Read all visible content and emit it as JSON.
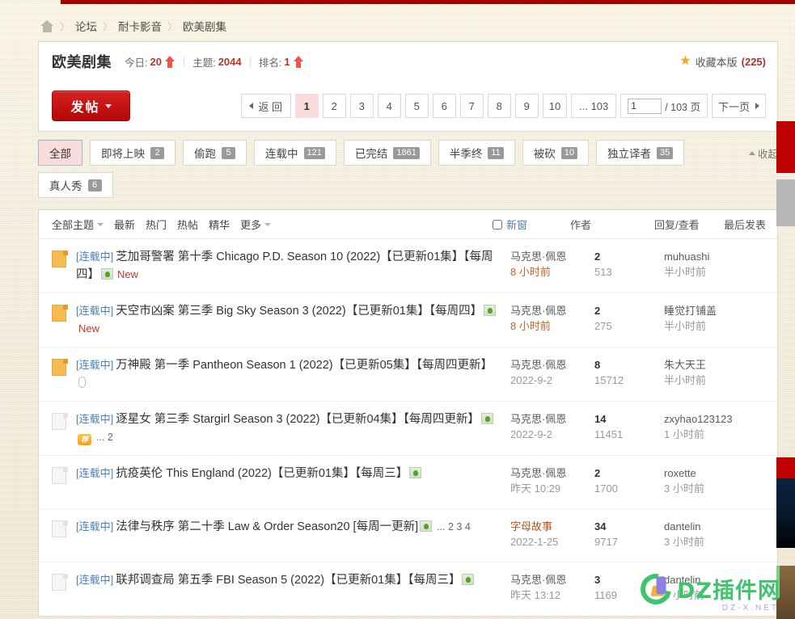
{
  "breadcrumb": {
    "home_icon": "home-icon",
    "items": [
      "论坛",
      "耐卡影音",
      "欧美剧集"
    ],
    "separator": "〉"
  },
  "forum_header": {
    "title": "欧美剧集",
    "today_label": "今日:",
    "today_value": "20",
    "threads_label": "主题:",
    "threads_value": "2044",
    "rank_label": "排名:",
    "rank_value": "1",
    "favorite_label": "收藏本版",
    "favorite_count": "(225)",
    "star_icon": "star-icon"
  },
  "actionbar": {
    "post_label": "发帖",
    "pager": {
      "back_label": "返 回",
      "pages": [
        "1",
        "2",
        "3",
        "4",
        "5",
        "6",
        "7",
        "8",
        "9",
        "10"
      ],
      "current": "1",
      "ellipsis_last": "... 103",
      "jump_value": "1",
      "jump_suffix": "/ 103 页",
      "next_label": "下一页"
    }
  },
  "filters": {
    "collapse_label": "收起",
    "tabs": [
      {
        "label": "全部",
        "count": "",
        "active": true
      },
      {
        "label": "即将上映",
        "count": "2",
        "active": false
      },
      {
        "label": "偷跑",
        "count": "5",
        "active": false
      },
      {
        "label": "连载中",
        "count": "121",
        "active": false
      },
      {
        "label": "已完结",
        "count": "1861",
        "active": false
      },
      {
        "label": "半季终",
        "count": "11",
        "active": false
      },
      {
        "label": "被砍",
        "count": "10",
        "active": false
      },
      {
        "label": "独立译者",
        "count": "35",
        "active": false
      },
      {
        "label": "真人秀",
        "count": "6",
        "active": false
      }
    ]
  },
  "list_header": {
    "all_topics": "全部主题",
    "sorts": [
      "最新",
      "热门",
      "热帖",
      "精华"
    ],
    "more": "更多",
    "newwindow": "新窗",
    "col_author": "作者",
    "col_replies_views": "回复/查看",
    "col_lastpost": "最后发表"
  },
  "threads": [
    {
      "icon": "folder-new-icon",
      "tag": "[连载中]",
      "title": "芝加哥警署 第十季 Chicago P.D. Season 10 (2022)【已更新01集】【每周四】",
      "badges": [
        "image-icon"
      ],
      "new": "New",
      "pages": "",
      "author": "马克思·佩恩",
      "date": "8 小时前",
      "date_hot": true,
      "replies": "2",
      "views": "513",
      "last_user": "muhuashi",
      "last_time": "半小时前"
    },
    {
      "icon": "folder-new-icon",
      "tag": "[连载中]",
      "title": "天空市凶案 第三季 Big Sky Season 3 (2022)【已更新01集】【每周四】",
      "badges": [
        "image-icon"
      ],
      "new": "New",
      "pages": "",
      "author": "马克思·佩恩",
      "date": "8 小时前",
      "date_hot": true,
      "replies": "2",
      "views": "275",
      "last_user": "睡觉打铺盖",
      "last_time": "半小时前"
    },
    {
      "icon": "folder-new-icon",
      "tag": "[连载中]",
      "title": "万神殿 第一季 Pantheon Season 1 (2022)【已更新05集】【每周四更新】",
      "badges": [
        "attachment-icon"
      ],
      "new": "",
      "pages": "",
      "author": "马克思·佩恩",
      "date": "2022-9-2",
      "date_hot": false,
      "replies": "8",
      "views": "15712",
      "last_user": "朱大天王",
      "last_time": "半小时前"
    },
    {
      "icon": "folder-icon",
      "tag": "[连载中]",
      "title": "逐星女 第三季 Stargirl Season 3 (2022)【已更新04集】【每周四更新】",
      "badges": [
        "image-icon",
        "recommend-icon"
      ],
      "new": "",
      "pages": "... 2",
      "author": "马克思·佩恩",
      "date": "2022-9-2",
      "date_hot": false,
      "replies": "14",
      "views": "11451",
      "last_user": "zxyhao123123",
      "last_time": "1 小时前"
    },
    {
      "icon": "folder-icon",
      "tag": "[连载中]",
      "title": "抗疫英伦 This England (2022)【已更新01集】【每周三】",
      "badges": [
        "image-icon"
      ],
      "new": "",
      "pages": "",
      "author": "马克思·佩恩",
      "date": "昨天 10:29",
      "date_hot": false,
      "replies": "2",
      "views": "1700",
      "last_user": "roxette",
      "last_time": "3 小时前"
    },
    {
      "icon": "folder-icon",
      "tag": "[连载中]",
      "title": "法律与秩序 第二十季 Law & Order Season20 [每周一更新]",
      "badges": [
        "image-icon"
      ],
      "new": "",
      "pages": "... 2 3 4",
      "author": "字母故事",
      "author_hot": true,
      "date": "2022-1-25",
      "date_hot": false,
      "replies": "34",
      "views": "9717",
      "last_user": "dantelin",
      "last_time": "3 小时前"
    },
    {
      "icon": "folder-icon",
      "tag": "[连载中]",
      "title": "联邦调查局 第五季 FBI Season 5 (2022)【已更新01集】【每周三】",
      "badges": [
        "image-icon"
      ],
      "new": "",
      "pages": "",
      "author": "马克思·佩恩",
      "date": "昨天 13:12",
      "date_hot": false,
      "replies": "3",
      "views": "1169",
      "last_user": "dantelin",
      "last_time": "3 小时前"
    }
  ],
  "watermark": {
    "text": "DZ插件网",
    "sub": "DZ-X.NET"
  },
  "colors": {
    "accent_red": "#c00000",
    "post_button": "#b30707",
    "link_blue": "#4a7fbd",
    "page_bg": "#f2ecd8"
  }
}
